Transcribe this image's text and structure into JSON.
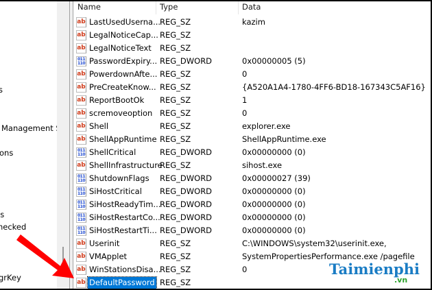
{
  "left_tree": [
    "s",
    "Management Se",
    "ons",
    "ls",
    "necked",
    "grKey"
  ],
  "columns": {
    "name": "Name",
    "type": "Type",
    "data": "Data"
  },
  "rows": [
    {
      "name": "LastUsedUserna...",
      "type": "REG_SZ",
      "data": "kazim",
      "icon": "string-value-icon"
    },
    {
      "name": "LegalNoticeCap...",
      "type": "REG_SZ",
      "data": "",
      "icon": "string-value-icon"
    },
    {
      "name": "LegalNoticeText",
      "type": "REG_SZ",
      "data": "",
      "icon": "string-value-icon"
    },
    {
      "name": "PasswordExpiry...",
      "type": "REG_DWORD",
      "data": "0x00000005 (5)",
      "icon": "dword-value-icon"
    },
    {
      "name": "PowerdownAfte...",
      "type": "REG_SZ",
      "data": "0",
      "icon": "string-value-icon"
    },
    {
      "name": "PreCreateKnow...",
      "type": "REG_SZ",
      "data": "{A520A1A4-1780-4FF6-BD18-167343C5AF16}",
      "icon": "string-value-icon"
    },
    {
      "name": "ReportBootOk",
      "type": "REG_SZ",
      "data": "1",
      "icon": "string-value-icon"
    },
    {
      "name": "scremoveoption",
      "type": "REG_SZ",
      "data": "0",
      "icon": "string-value-icon"
    },
    {
      "name": "Shell",
      "type": "REG_SZ",
      "data": "explorer.exe",
      "icon": "string-value-icon"
    },
    {
      "name": "ShellAppRuntime",
      "type": "REG_SZ",
      "data": "ShellAppRuntime.exe",
      "icon": "string-value-icon"
    },
    {
      "name": "ShellCritical",
      "type": "REG_DWORD",
      "data": "0x00000000 (0)",
      "icon": "dword-value-icon"
    },
    {
      "name": "ShellInfrastructure",
      "type": "REG_SZ",
      "data": "sihost.exe",
      "icon": "string-value-icon"
    },
    {
      "name": "ShutdownFlags",
      "type": "REG_DWORD",
      "data": "0x00000027 (39)",
      "icon": "dword-value-icon"
    },
    {
      "name": "SiHostCritical",
      "type": "REG_DWORD",
      "data": "0x00000000 (0)",
      "icon": "dword-value-icon"
    },
    {
      "name": "SiHostReadyTim...",
      "type": "REG_DWORD",
      "data": "0x00000000 (0)",
      "icon": "dword-value-icon"
    },
    {
      "name": "SiHostRestartCo...",
      "type": "REG_DWORD",
      "data": "0x00000000 (0)",
      "icon": "dword-value-icon"
    },
    {
      "name": "SiHostRestartTi...",
      "type": "REG_DWORD",
      "data": "0x00000000 (0)",
      "icon": "dword-value-icon"
    },
    {
      "name": "Userinit",
      "type": "REG_SZ",
      "data": "C:\\WINDOWS\\system32\\userinit.exe,",
      "icon": "string-value-icon"
    },
    {
      "name": "VMApplet",
      "type": "REG_SZ",
      "data": "SystemPropertiesPerformance.exe /pagefile",
      "icon": "string-value-icon"
    },
    {
      "name": "WinStationsDisa...",
      "type": "REG_SZ",
      "data": "0",
      "icon": "string-value-icon"
    },
    {
      "name": "DefaultPassword",
      "type": "REG_SZ",
      "data": "",
      "icon": "string-value-icon",
      "selected": true
    }
  ],
  "icon_glyphs": {
    "string": "ab",
    "dword": "011\n110"
  },
  "colors": {
    "selection": "#0078d7",
    "arrow": "#ff0000",
    "string_icon": "#d03b1a",
    "dword_icon": "#1a46d0"
  },
  "watermark": {
    "brand": "Taimienphi",
    "tld": ".vn"
  }
}
